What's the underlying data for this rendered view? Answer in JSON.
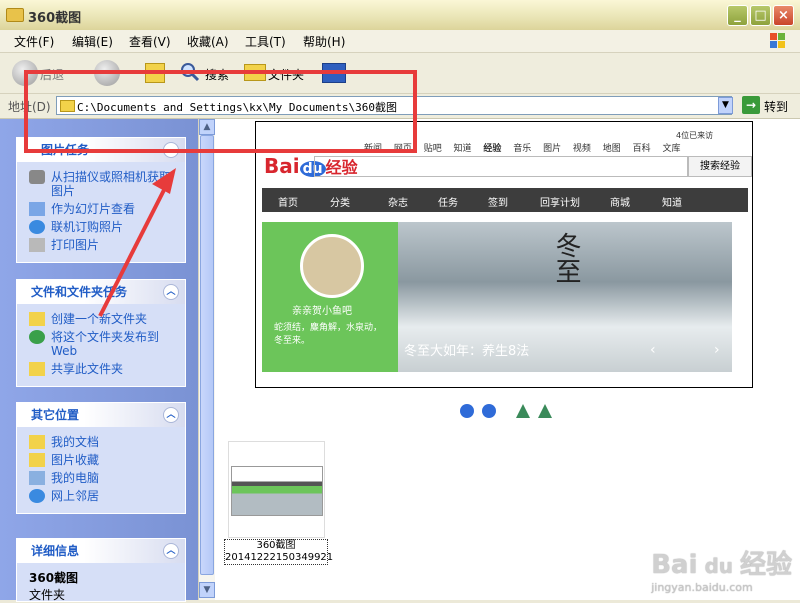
{
  "window": {
    "title": "360截图"
  },
  "menu": [
    "文件(F)",
    "编辑(E)",
    "查看(V)",
    "收藏(A)",
    "工具(T)",
    "帮助(H)"
  ],
  "toolbar": {
    "back": "后退",
    "search": "搜索",
    "folders": "文件夹"
  },
  "address": {
    "label": "地址(D)",
    "path": "C:\\Documents and Settings\\kx\\My Documents\\360截图",
    "go": "转到"
  },
  "panels": {
    "picture_tasks": {
      "title": "图片任务",
      "items": [
        "从扫描仪或照相机获取图片",
        "作为幻灯片查看",
        "联机订购照片",
        "打印图片"
      ]
    },
    "file_tasks": {
      "title": "文件和文件夹任务",
      "items": [
        "创建一个新文件夹",
        "将这个文件夹发布到 Web",
        "共享此文件夹"
      ]
    },
    "other_places": {
      "title": "其它位置",
      "items": [
        "我的文档",
        "图片收藏",
        "我的电脑",
        "网上邻居"
      ]
    },
    "details": {
      "title": "详细信息",
      "name": "360截图",
      "type": "文件夹"
    }
  },
  "preview": {
    "logo": "Bai",
    "logo_jingyan": "经验",
    "nav": [
      "新闻",
      "网页",
      "贴吧",
      "知道",
      "经验",
      "音乐",
      "图片",
      "视频",
      "地图",
      "百科",
      "文库"
    ],
    "user_text": "4位已来访",
    "search_button": "搜索经验",
    "tabs": [
      "首页",
      "分类",
      "杂志",
      "任务",
      "签到",
      "回享计划",
      "商城",
      "知道"
    ],
    "card_name": "亲亲贺小鱼吧",
    "card_quote": "蛇须结，麋角解，水泉动，冬至来。",
    "banner_title": "冬至",
    "banner_caption": "冬至大如年：养生8法"
  },
  "thumbnail": {
    "name": "360截图",
    "filename": "20141222150349921"
  },
  "watermark": {
    "brand": "Bai",
    "brand_jy": "经验",
    "url": "jingyan.baidu.com"
  },
  "colors": {
    "annotation_red": "#e73b3b",
    "xp_link_blue": "#215dc6",
    "task_pane_blue": "#7a92d4"
  }
}
